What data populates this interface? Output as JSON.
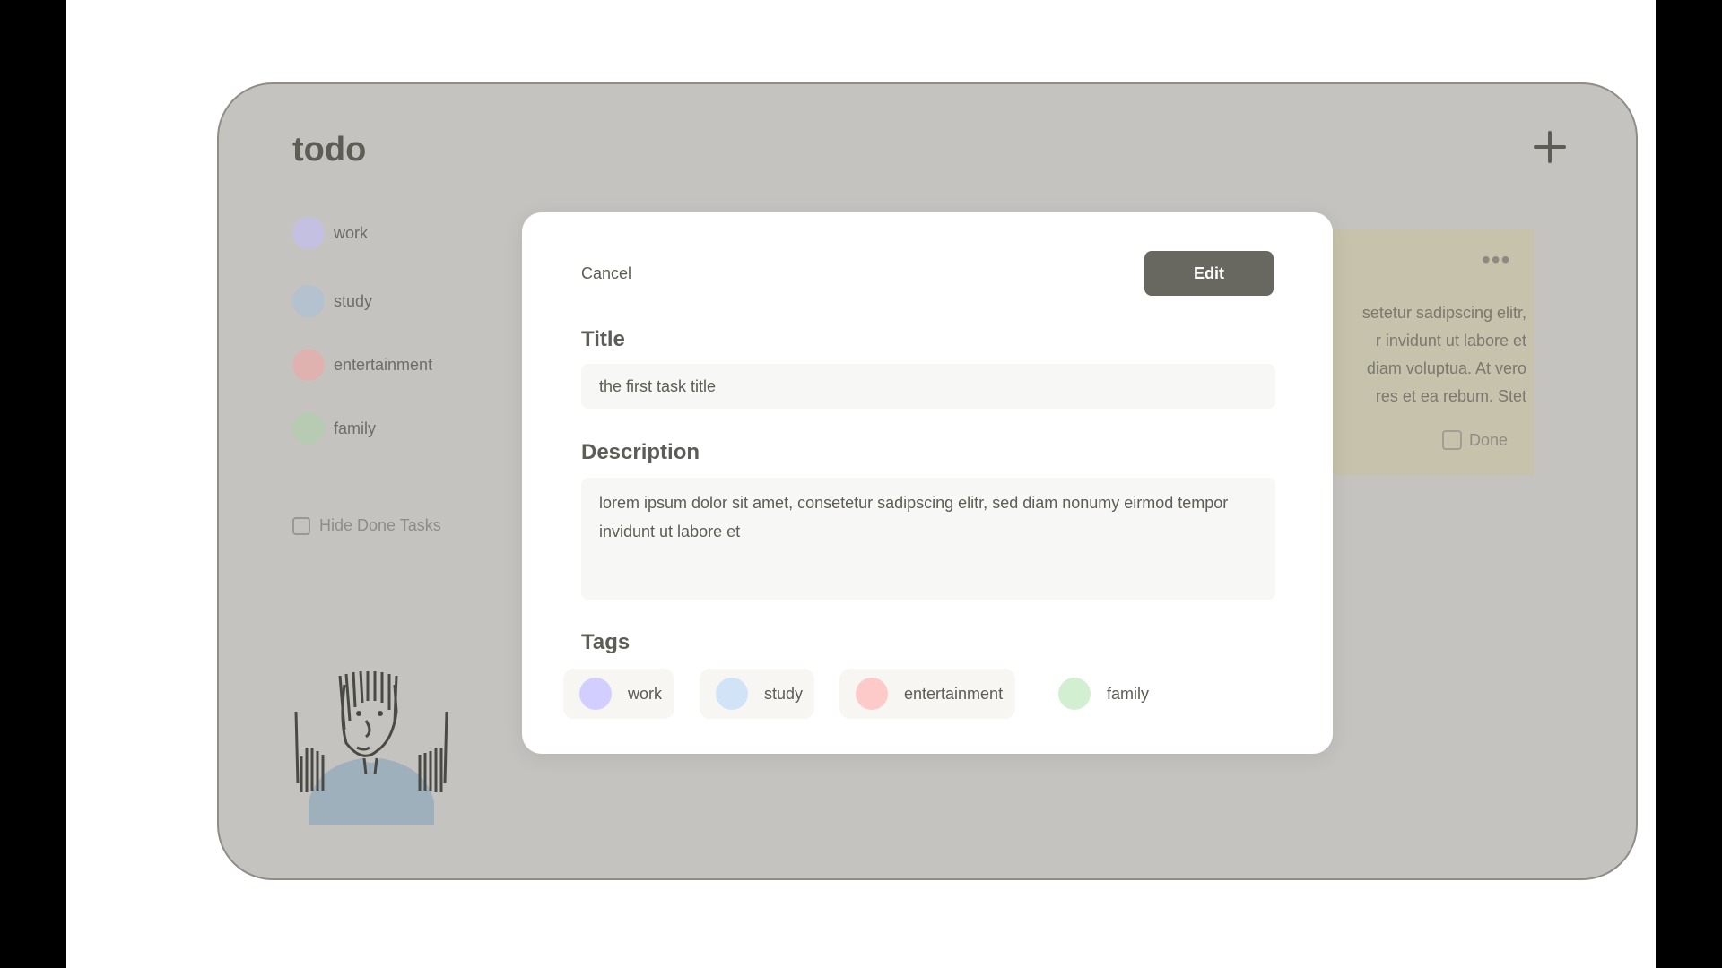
{
  "app": {
    "logo": "todo",
    "add_icon": "plus-icon"
  },
  "sidebar": {
    "items": [
      {
        "label": "work",
        "color": "#c3c0e2"
      },
      {
        "label": "study",
        "color": "#b4c2d0"
      },
      {
        "label": "entertainment",
        "color": "#dfb2b0"
      },
      {
        "label": "family",
        "color": "#b6cbb1"
      }
    ],
    "hide_done_label": "Hide Done Tasks"
  },
  "background_card": {
    "text_lines": [
      "setetur sadipscing elitr,",
      "r invidunt ut labore et",
      "diam voluptua. At vero",
      "res et ea rebum. Stet"
    ],
    "more_icon": "ellipsis-icon",
    "done_label": "Done"
  },
  "modal": {
    "cancel_label": "Cancel",
    "edit_label": "Edit",
    "title_label": "Title",
    "title_value": "the first task title",
    "description_label": "Description",
    "description_value": "lorem ipsum dolor sit amet, consetetur sadipscing elitr,  sed diam nonumy eirmod tempor invidunt ut labore et",
    "tags_label": "Tags",
    "tags": [
      {
        "label": "work",
        "color": "#d2ceff"
      },
      {
        "label": "study",
        "color": "#d1e4f7"
      },
      {
        "label": "entertainment",
        "color": "#fdc9c9"
      },
      {
        "label": "family",
        "color": "#d3efd1"
      }
    ]
  }
}
